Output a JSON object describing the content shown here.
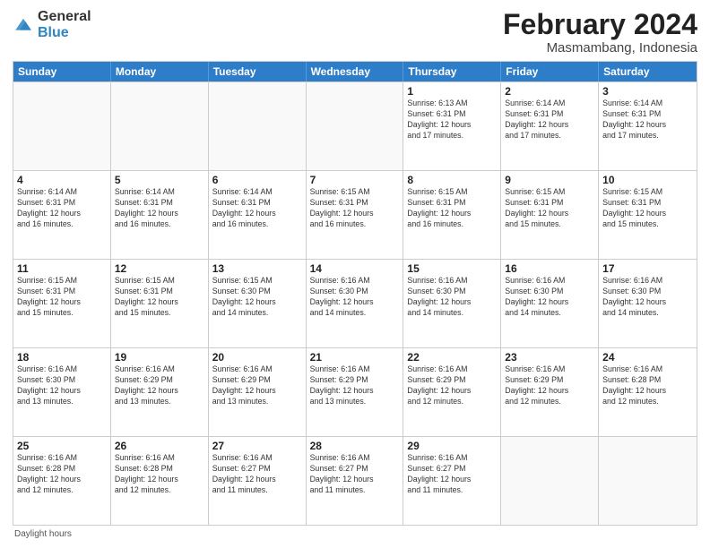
{
  "header": {
    "logo_general": "General",
    "logo_blue": "Blue",
    "main_title": "February 2024",
    "subtitle": "Masmambang, Indonesia"
  },
  "calendar": {
    "days_of_week": [
      "Sunday",
      "Monday",
      "Tuesday",
      "Wednesday",
      "Thursday",
      "Friday",
      "Saturday"
    ],
    "weeks": [
      [
        {
          "day": "",
          "info": ""
        },
        {
          "day": "",
          "info": ""
        },
        {
          "day": "",
          "info": ""
        },
        {
          "day": "",
          "info": ""
        },
        {
          "day": "1",
          "info": "Sunrise: 6:13 AM\nSunset: 6:31 PM\nDaylight: 12 hours\nand 17 minutes."
        },
        {
          "day": "2",
          "info": "Sunrise: 6:14 AM\nSunset: 6:31 PM\nDaylight: 12 hours\nand 17 minutes."
        },
        {
          "day": "3",
          "info": "Sunrise: 6:14 AM\nSunset: 6:31 PM\nDaylight: 12 hours\nand 17 minutes."
        }
      ],
      [
        {
          "day": "4",
          "info": "Sunrise: 6:14 AM\nSunset: 6:31 PM\nDaylight: 12 hours\nand 16 minutes."
        },
        {
          "day": "5",
          "info": "Sunrise: 6:14 AM\nSunset: 6:31 PM\nDaylight: 12 hours\nand 16 minutes."
        },
        {
          "day": "6",
          "info": "Sunrise: 6:14 AM\nSunset: 6:31 PM\nDaylight: 12 hours\nand 16 minutes."
        },
        {
          "day": "7",
          "info": "Sunrise: 6:15 AM\nSunset: 6:31 PM\nDaylight: 12 hours\nand 16 minutes."
        },
        {
          "day": "8",
          "info": "Sunrise: 6:15 AM\nSunset: 6:31 PM\nDaylight: 12 hours\nand 16 minutes."
        },
        {
          "day": "9",
          "info": "Sunrise: 6:15 AM\nSunset: 6:31 PM\nDaylight: 12 hours\nand 15 minutes."
        },
        {
          "day": "10",
          "info": "Sunrise: 6:15 AM\nSunset: 6:31 PM\nDaylight: 12 hours\nand 15 minutes."
        }
      ],
      [
        {
          "day": "11",
          "info": "Sunrise: 6:15 AM\nSunset: 6:31 PM\nDaylight: 12 hours\nand 15 minutes."
        },
        {
          "day": "12",
          "info": "Sunrise: 6:15 AM\nSunset: 6:31 PM\nDaylight: 12 hours\nand 15 minutes."
        },
        {
          "day": "13",
          "info": "Sunrise: 6:15 AM\nSunset: 6:30 PM\nDaylight: 12 hours\nand 14 minutes."
        },
        {
          "day": "14",
          "info": "Sunrise: 6:16 AM\nSunset: 6:30 PM\nDaylight: 12 hours\nand 14 minutes."
        },
        {
          "day": "15",
          "info": "Sunrise: 6:16 AM\nSunset: 6:30 PM\nDaylight: 12 hours\nand 14 minutes."
        },
        {
          "day": "16",
          "info": "Sunrise: 6:16 AM\nSunset: 6:30 PM\nDaylight: 12 hours\nand 14 minutes."
        },
        {
          "day": "17",
          "info": "Sunrise: 6:16 AM\nSunset: 6:30 PM\nDaylight: 12 hours\nand 14 minutes."
        }
      ],
      [
        {
          "day": "18",
          "info": "Sunrise: 6:16 AM\nSunset: 6:30 PM\nDaylight: 12 hours\nand 13 minutes."
        },
        {
          "day": "19",
          "info": "Sunrise: 6:16 AM\nSunset: 6:29 PM\nDaylight: 12 hours\nand 13 minutes."
        },
        {
          "day": "20",
          "info": "Sunrise: 6:16 AM\nSunset: 6:29 PM\nDaylight: 12 hours\nand 13 minutes."
        },
        {
          "day": "21",
          "info": "Sunrise: 6:16 AM\nSunset: 6:29 PM\nDaylight: 12 hours\nand 13 minutes."
        },
        {
          "day": "22",
          "info": "Sunrise: 6:16 AM\nSunset: 6:29 PM\nDaylight: 12 hours\nand 12 minutes."
        },
        {
          "day": "23",
          "info": "Sunrise: 6:16 AM\nSunset: 6:29 PM\nDaylight: 12 hours\nand 12 minutes."
        },
        {
          "day": "24",
          "info": "Sunrise: 6:16 AM\nSunset: 6:28 PM\nDaylight: 12 hours\nand 12 minutes."
        }
      ],
      [
        {
          "day": "25",
          "info": "Sunrise: 6:16 AM\nSunset: 6:28 PM\nDaylight: 12 hours\nand 12 minutes."
        },
        {
          "day": "26",
          "info": "Sunrise: 6:16 AM\nSunset: 6:28 PM\nDaylight: 12 hours\nand 12 minutes."
        },
        {
          "day": "27",
          "info": "Sunrise: 6:16 AM\nSunset: 6:27 PM\nDaylight: 12 hours\nand 11 minutes."
        },
        {
          "day": "28",
          "info": "Sunrise: 6:16 AM\nSunset: 6:27 PM\nDaylight: 12 hours\nand 11 minutes."
        },
        {
          "day": "29",
          "info": "Sunrise: 6:16 AM\nSunset: 6:27 PM\nDaylight: 12 hours\nand 11 minutes."
        },
        {
          "day": "",
          "info": ""
        },
        {
          "day": "",
          "info": ""
        }
      ]
    ]
  },
  "footer": {
    "note": "Daylight hours"
  }
}
